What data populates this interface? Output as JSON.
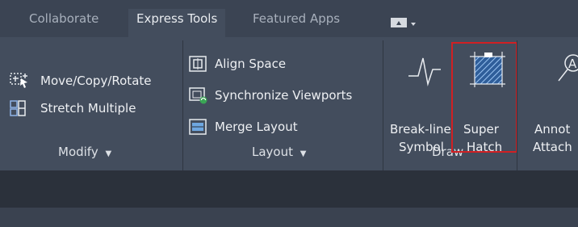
{
  "tabs": [
    {
      "label": "Collaborate"
    },
    {
      "label": "Express Tools"
    },
    {
      "label": "Featured Apps"
    }
  ],
  "panels": {
    "modify": {
      "title": "Modify",
      "items": [
        {
          "label": "Move/Copy/Rotate",
          "icon": "move-copy-rotate-icon"
        },
        {
          "label": "Stretch Multiple",
          "icon": "stretch-multiple-icon"
        }
      ]
    },
    "layout": {
      "title": "Layout",
      "items": [
        {
          "label": "Align Space",
          "icon": "align-space-icon"
        },
        {
          "label": "Synchronize Viewports",
          "icon": "synchronize-viewports-icon"
        },
        {
          "label": "Merge Layout",
          "icon": "merge-layout-icon"
        }
      ]
    },
    "draw": {
      "title": "Draw",
      "items": [
        {
          "line1": "Break-line",
          "line2": "Symbol",
          "icon": "break-line-icon"
        },
        {
          "line1": "Super",
          "line2": "Hatch",
          "icon": "super-hatch-icon"
        }
      ]
    },
    "partial": {
      "line1": "Annot",
      "line2": "Attach"
    }
  },
  "colors": {
    "highlight": "#d12023"
  }
}
